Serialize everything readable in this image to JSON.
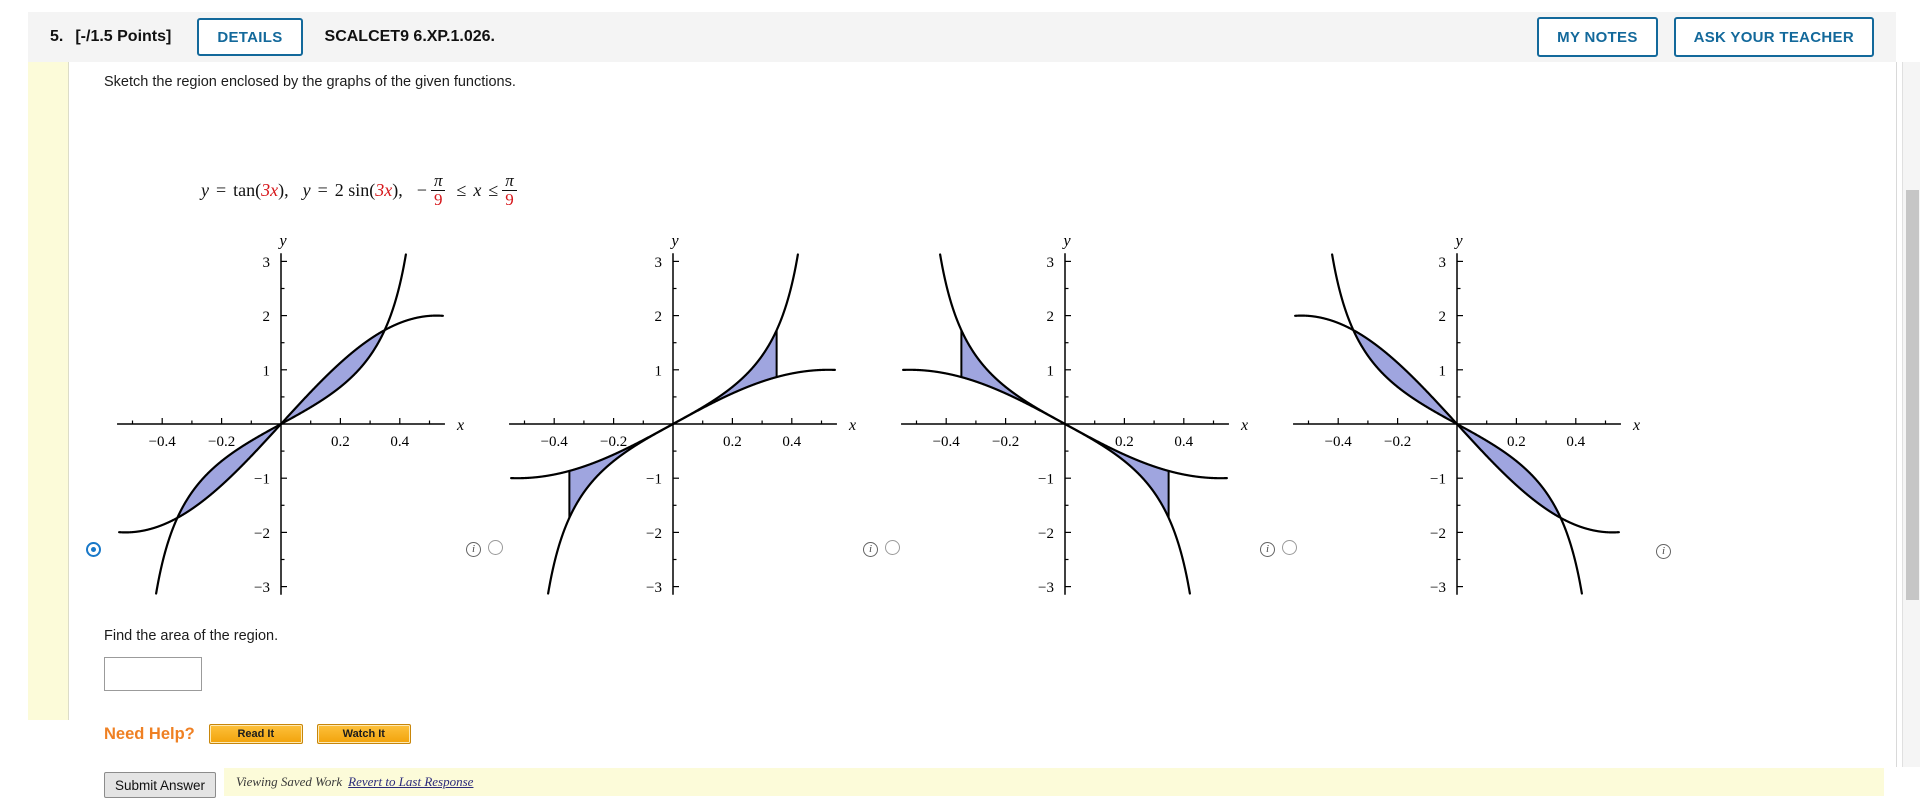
{
  "header": {
    "question_number": "5.",
    "points": "[-/1.5 Points]",
    "details_label": "DETAILS",
    "assignment_code": "SCALCET9 6.XP.1.026.",
    "my_notes_label": "MY NOTES",
    "ask_teacher_label": "ASK YOUR TEACHER"
  },
  "problem": {
    "prompt": "Sketch the region enclosed by the graphs of the given functions.",
    "equation": {
      "f1_y": "y",
      "f1_eq": "=",
      "f1_name": "tan(",
      "f1_arg": "3x",
      "f1_close": "),",
      "f2_y": "y",
      "f2_eq": "=",
      "f2_name": "2 sin(",
      "f2_arg": "3x",
      "f2_close": "),",
      "minus": "−",
      "frac1_num": "π",
      "frac1_den": "9",
      "ineq1": "≤",
      "var": "x",
      "ineq2": "≤",
      "frac2_num": "π",
      "frac2_den": "9"
    },
    "find_area_label": "Find the area of the region.",
    "answer_value": "",
    "answer_placeholder": ""
  },
  "need_help": {
    "label": "Need Help?",
    "read_it": "Read It",
    "watch_it": "Watch It"
  },
  "footer": {
    "submit_label": "Submit Answer",
    "saved_work_label": "Viewing Saved Work",
    "revert_link": "Revert to Last Response"
  },
  "chart_data": {
    "type": "line",
    "shared": {
      "xlabel": "x",
      "ylabel": "y",
      "xticks": [
        -0.4,
        -0.2,
        0.2,
        0.4
      ],
      "xtick_labels": [
        "−0.4",
        "−0.2",
        "0.2",
        "0.4"
      ],
      "yticks": [
        3,
        2,
        1,
        -1,
        -2,
        -3
      ],
      "ytick_labels": [
        "3",
        "2",
        "1",
        "−1",
        "−2",
        "−3"
      ],
      "xlim": [
        -0.55,
        0.55
      ],
      "ylim": [
        -3.15,
        3.15
      ],
      "grid": false,
      "legend": "none",
      "curve_color": "#000000",
      "shade_color": "#9aa0dd",
      "intersection_x": 0.3489,
      "intersection_y": 1.732
    },
    "panels": [
      {
        "id": 1,
        "selected": true,
        "series": [
          {
            "name": "y = tan(3x)",
            "expr": "tan(3x)",
            "sign": 1
          },
          {
            "name": "y = 2 sin(3x)",
            "expr": "2 sin(3x)",
            "sign": 1
          }
        ],
        "shaded_regions": [
          {
            "x_from": -0.3489,
            "x_to": 0.0,
            "style": "lens"
          },
          {
            "x_from": 0.0,
            "x_to": 0.3489,
            "style": "lens"
          }
        ],
        "radio_label": "choice-1"
      },
      {
        "id": 2,
        "selected": false,
        "series": [
          {
            "name": "y = tan(3x)",
            "expr": "tan(3x)",
            "sign": 1
          },
          {
            "name": "y = sin(3x)",
            "expr": "sin(3x)",
            "sign": 1
          }
        ],
        "shaded_regions": [
          {
            "x_from": -0.3489,
            "x_to": 0.0,
            "style": "cusp"
          },
          {
            "x_from": 0.0,
            "x_to": 0.3489,
            "style": "cusp"
          }
        ],
        "radio_label": "choice-2"
      },
      {
        "id": 3,
        "selected": false,
        "series": [
          {
            "name": "y = -tan(3x)",
            "expr": "-tan(3x)",
            "sign": -1
          },
          {
            "name": "y = -sin(3x)",
            "expr": "-sin(3x)",
            "sign": -1
          }
        ],
        "shaded_regions": [
          {
            "x_from": -0.3489,
            "x_to": 0.0,
            "style": "cusp"
          },
          {
            "x_from": 0.0,
            "x_to": 0.3489,
            "style": "cusp"
          }
        ],
        "radio_label": "choice-3"
      },
      {
        "id": 4,
        "selected": false,
        "series": [
          {
            "name": "y = -tan(3x)",
            "expr": "-tan(3x)",
            "sign": -1
          },
          {
            "name": "y = -2 sin(3x)",
            "expr": "-2 sin(3x)",
            "sign": -1
          }
        ],
        "shaded_regions": [
          {
            "x_from": -0.3489,
            "x_to": 0.0,
            "style": "lens"
          },
          {
            "x_from": 0.0,
            "x_to": 0.3489,
            "style": "lens"
          }
        ],
        "radio_label": "choice-4"
      }
    ]
  }
}
